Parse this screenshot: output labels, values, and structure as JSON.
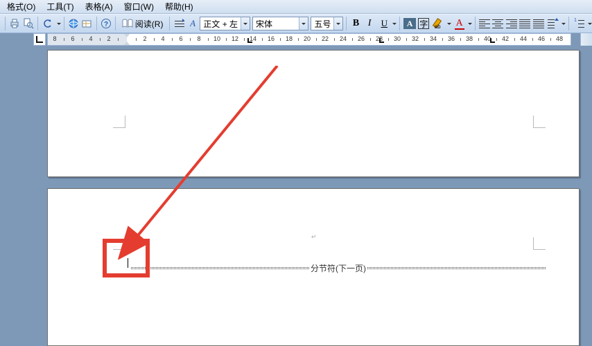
{
  "menu": {
    "format": "格式(O)",
    "tools": "工具(T)",
    "table": "表格(A)",
    "window": "窗口(W)",
    "help": "帮助(H)"
  },
  "toolbar": {
    "read_label": "阅读(R)",
    "style_combo": "正文 + 左",
    "font_combo": "宋体",
    "size_combo": "五号",
    "bold": "B",
    "italic": "I",
    "underline": "U",
    "boxed_a": "A",
    "char_a": "A",
    "bordered_a": "字"
  },
  "ruler": {
    "labels": [
      "8",
      "6",
      "4",
      "2",
      "",
      "2",
      "4",
      "6",
      "8",
      "10",
      "12",
      "14",
      "16",
      "18",
      "20",
      "22",
      "24",
      "26",
      "28",
      "30",
      "32",
      "34",
      "36",
      "38",
      "40",
      "42",
      "44",
      "46",
      "48"
    ]
  },
  "document": {
    "section_break_label": "分节符(下一页)"
  }
}
